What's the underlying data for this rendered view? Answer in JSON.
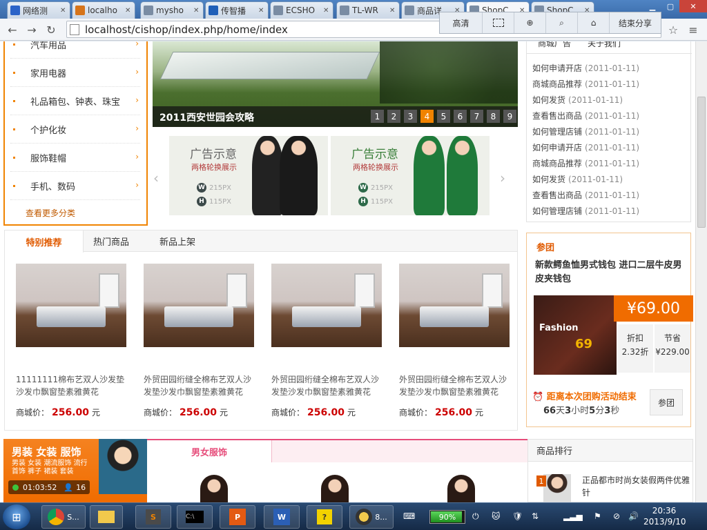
{
  "tabs": [
    {
      "label": "网络测",
      "color": "#2b63c8",
      "icon": "paw-icon"
    },
    {
      "label": "localho",
      "color": "#d6741a",
      "icon": "pma-icon"
    },
    {
      "label": "mysho",
      "color": "#7a8ca3",
      "icon": "doc-icon"
    },
    {
      "label": "传智播",
      "color": "#1f5fb8",
      "icon": "swirl-icon"
    },
    {
      "label": "ECSHO",
      "color": "#7a8ca3",
      "icon": "doc-icon"
    },
    {
      "label": "TL-WR",
      "color": "#7a8ca3",
      "icon": "doc-icon"
    },
    {
      "label": "商品详",
      "color": "#7a8ca3",
      "icon": "doc-icon"
    },
    {
      "label": "ShopC",
      "color": "#7a8ca3",
      "icon": "doc-icon"
    },
    {
      "label": "ShopC",
      "color": "#7a8ca3",
      "icon": "doc-icon"
    }
  ],
  "address": "localhost/cishop/index.php/home/index",
  "sharebar": [
    "高清",
    "结束分享"
  ],
  "categories": [
    "汽车用品",
    "家用电器",
    "礼品箱包、钟表、珠宝",
    "个护化妆",
    "服饰鞋帽",
    "手机、数码"
  ],
  "cat_more": "查看更多分类",
  "banner": {
    "caption": "2011西安世园会攻略",
    "pages": [
      "1",
      "2",
      "3",
      "4",
      "5",
      "6",
      "7",
      "8",
      "9"
    ],
    "active": "4"
  },
  "ads": [
    {
      "t1": "广告示意",
      "t2": "两格轮换展示",
      "w": "215PX",
      "h": "115PX"
    },
    {
      "t1": "广告示意",
      "t2": "两格轮换展示",
      "w": "215PX",
      "h": "115PX"
    }
  ],
  "news_tabs": [
    "商城广告",
    "关于我们"
  ],
  "news": [
    {
      "t": "如何申请开店",
      "d": "(2011-01-11)"
    },
    {
      "t": "商城商品推荐",
      "d": "(2011-01-11)"
    },
    {
      "t": "如何发货",
      "d": "(2011-01-11)"
    },
    {
      "t": "查看售出商品",
      "d": "(2011-01-11)"
    },
    {
      "t": "如何管理店铺",
      "d": "(2011-01-11)"
    },
    {
      "t": "如何申请开店",
      "d": "(2011-01-11)"
    },
    {
      "t": "商城商品推荐",
      "d": "(2011-01-11)"
    },
    {
      "t": "如何发货",
      "d": "(2011-01-11)"
    },
    {
      "t": "查看售出商品",
      "d": "(2011-01-11)"
    },
    {
      "t": "如何管理店铺",
      "d": "(2011-01-11)"
    }
  ],
  "rec_tabs": [
    "特别推荐",
    "热门商品",
    "新品上架"
  ],
  "products": [
    {
      "name": "11111111棉布艺双人沙发垫沙发巾飘窗垫素雅黄花",
      "label": "商城价：",
      "price": "256.00",
      "unit": "元"
    },
    {
      "name": "外贸田园绗缝全棉布艺双人沙发垫沙发巾飘窗垫素雅黄花",
      "label": "商城价：",
      "price": "256.00",
      "unit": "元"
    },
    {
      "name": "外贸田园绗缝全棉布艺双人沙发垫沙发巾飘窗垫素雅黄花",
      "label": "商城价：",
      "price": "256.00",
      "unit": "元"
    },
    {
      "name": "外贸田园绗缝全棉布艺双人沙发垫沙发巾飘窗垫素雅黄花",
      "label": "商城价：",
      "price": "256.00",
      "unit": "元"
    }
  ],
  "tuan": {
    "heading": "参团",
    "title": "新款鳄鱼恤男式钱包 进口二层牛皮男皮夹钱包",
    "price": "¥69.00",
    "pic_text": "Fashion",
    "pic_num": "69",
    "discount_label": "折扣",
    "discount": "2.32折",
    "save_label": "节省",
    "save": "¥229.00",
    "countdown_label": "距离本次团购活动结束",
    "countdown": {
      "d": "66",
      "d_u": "天",
      "h": "3",
      "h_u": "小时",
      "m": "5",
      "m_u": "分",
      "s": "3",
      "s_u": "秒"
    },
    "button": "参团"
  },
  "floor_banner": {
    "title": "男装 女装 服饰",
    "sub": "男装 女装 潮流服饰 流行首饰 裤子 裙装 套装"
  },
  "floor_tab": "男女服饰",
  "rank": {
    "heading": "商品排行",
    "no": "1",
    "text": "正品都市时尚女装假两件优雅针"
  },
  "video": {
    "time": "01:03:52",
    "viewers": "16"
  },
  "taskbar": {
    "chrome_label": "S...",
    "qq_label": "8...",
    "battery": "90%",
    "time": "20:36",
    "date": "2013/9/10"
  }
}
